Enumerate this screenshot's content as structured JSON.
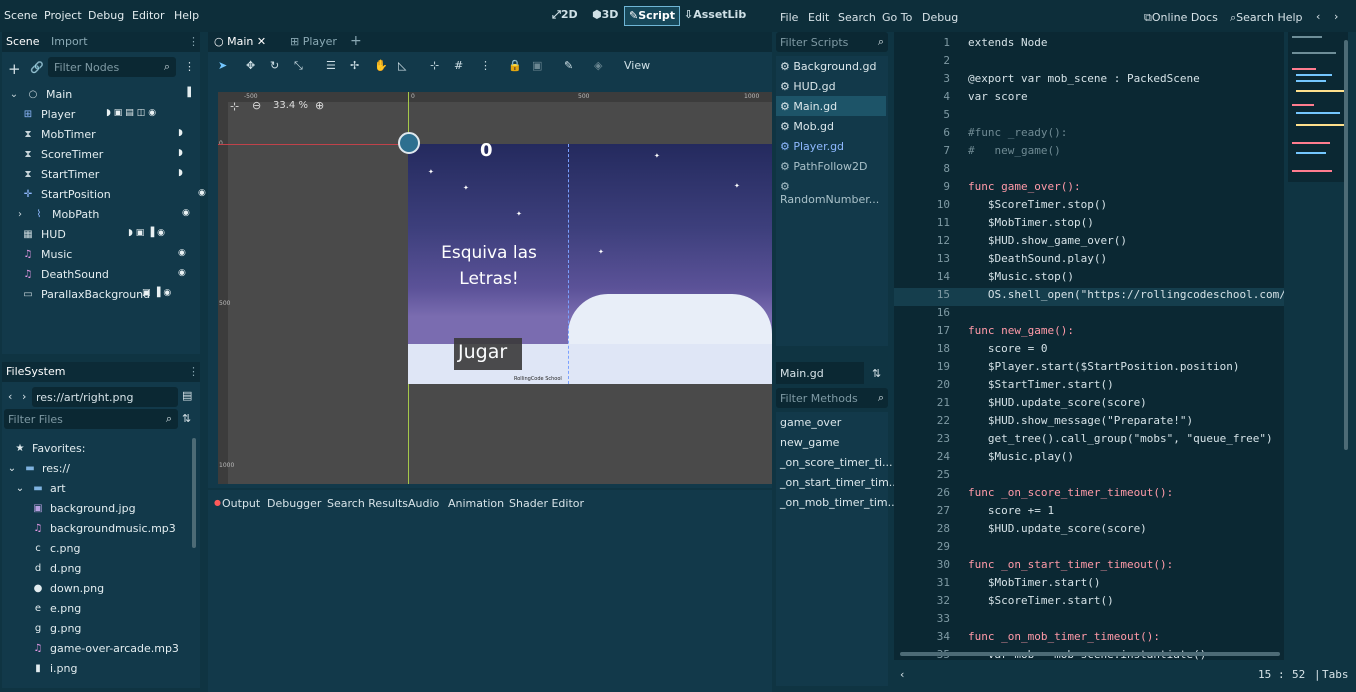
{
  "menu": [
    "Scene",
    "Project",
    "Debug",
    "Editor",
    "Help"
  ],
  "modes": [
    "2D",
    "3D",
    "Script",
    "AssetLib"
  ],
  "active_mode": "Script",
  "scene_dock": {
    "tabs": [
      "Scene",
      "Import"
    ],
    "filter_placeholder": "Filter Nodes",
    "nodes": [
      "Main",
      "Player",
      "MobTimer",
      "ScoreTimer",
      "StartTimer",
      "StartPosition",
      "MobPath",
      "HUD",
      "Music",
      "DeathSound",
      "ParallaxBackground"
    ]
  },
  "filesystem": {
    "title": "FileSystem",
    "path": "res://art/right.png",
    "filter_placeholder": "Filter Files",
    "favorites": "Favorites:",
    "root": "res://",
    "folder": "art",
    "files": [
      "background.jpg",
      "backgroundmusic.mp3",
      "c.png",
      "d.png",
      "down.png",
      "e.png",
      "g.png",
      "game-over-arcade.mp3",
      "i.png"
    ]
  },
  "editor_tabs": [
    "Main",
    "Player"
  ],
  "viewport": {
    "zoom": "33.4 %",
    "view_label": "View",
    "ruler_marks": [
      "-500",
      "0",
      "500",
      "1000"
    ],
    "v_ruler_marks": [
      "0",
      "500",
      "1000"
    ],
    "game": {
      "score": "0",
      "message": "Esquiva las Letras!",
      "button": "Jugar",
      "credit": "RollingCode School"
    }
  },
  "bottom_tabs": [
    "Output",
    "Debugger",
    "Search Results",
    "Audio",
    "Animation",
    "Shader Editor"
  ],
  "script_menu": [
    "File",
    "Edit",
    "Search",
    "Go To",
    "Debug"
  ],
  "script_help": [
    "Online Docs",
    "Search Help"
  ],
  "script_filter_placeholder": "Filter Scripts",
  "scripts": [
    "Background.gd",
    "HUD.gd",
    "Main.gd",
    "Mob.gd",
    "Player.gd",
    "PathFollow2D",
    "RandomNumber..."
  ],
  "current_script": "Main.gd",
  "methods_filter_placeholder": "Filter Methods",
  "methods": [
    "game_over",
    "new_game",
    "_on_score_timer_ti...",
    "_on_start_timer_tim...",
    "_on_mob_timer_tim..."
  ],
  "code": [
    "extends Node",
    "",
    "@export var mob_scene : PackedScene",
    "var score",
    "",
    "#func _ready():",
    "#\tnew_game()",
    "",
    "func game_over():",
    "\t$ScoreTimer.stop()",
    "\t$MobTimer.stop()",
    "\t$HUD.show_game_over()",
    "\t$DeathSound.play()",
    "\t$Music.stop()",
    "\tOS.shell_open(\"https://rollingcodeschool.com/\")",
    "",
    "func new_game():",
    "\tscore = 0",
    "\t$Player.start($StartPosition.position)",
    "\t$StartTimer.start()",
    "\t$HUD.update_score(score)",
    "\t$HUD.show_message(\"Preparate!\")",
    "\tget_tree().call_group(\"mobs\", \"queue_free\")",
    "\t$Music.play()",
    "",
    "func _on_score_timer_timeout():",
    "\tscore += 1",
    "\t$HUD.update_score(score)",
    "",
    "func _on_start_timer_timeout():",
    "\t$MobTimer.start()",
    "\t$ScoreTimer.start()",
    "",
    "func _on_mob_timer_timeout():",
    "\tvar mob = mob_scene.instantiate()"
  ],
  "status": {
    "line": "15",
    "col": "52",
    "indent": "Tabs"
  },
  "colors": {
    "accent": "#6fb6d6",
    "keyword": "#ff7c8f",
    "function": "#74c7ff",
    "string": "#ffe08c"
  }
}
